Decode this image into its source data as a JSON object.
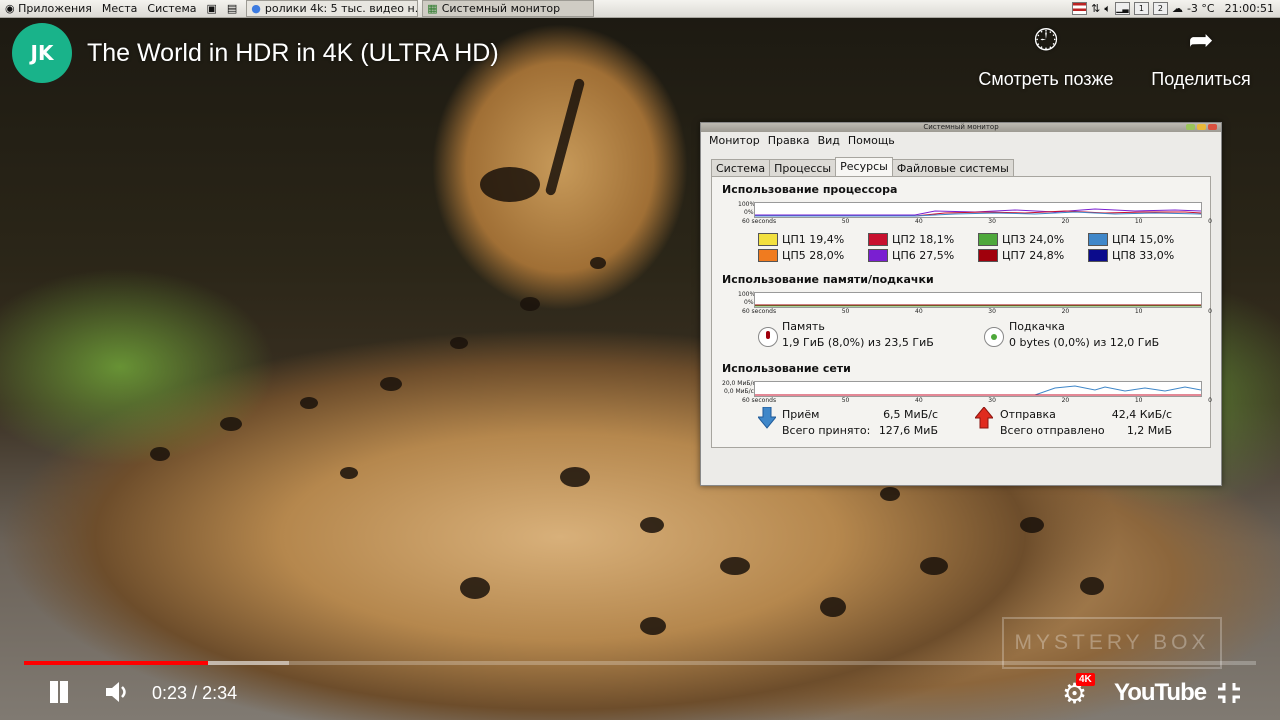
{
  "panel": {
    "menu_apps": "Приложения",
    "menu_places": "Места",
    "menu_system": "Система",
    "task_browser": "ролики 4k: 5 тыс. видео н...",
    "task_monitor": "Системный монитор",
    "weather": "-3 °C",
    "clock": "21:00:51"
  },
  "video": {
    "title": "The World in HDR in 4K (ULTRA HD)",
    "channel_logo_letters": "JK",
    "watch_later": "Смотреть позже",
    "share": "Поделиться",
    "watermark": "MYSTERY BOX",
    "time_current": "0:23",
    "time_total": "2:34",
    "time_separator": " / ",
    "progress_played_pct": 14.9,
    "progress_buffered_pct": 21.5,
    "quality_badge": "4K",
    "brand": "YouTube"
  },
  "monitor": {
    "window_title": "Системный монитор",
    "menu": [
      "Монитор",
      "Правка",
      "Вид",
      "Помощь"
    ],
    "tabs": [
      "Система",
      "Процессы",
      "Ресурсы",
      "Файловые системы"
    ],
    "active_tab": 2,
    "cpu": {
      "heading": "Использование процессора",
      "y_top": "100%",
      "y_bottom": "0%",
      "x_ticks": [
        "60 seconds",
        "50",
        "40",
        "30",
        "20",
        "10",
        "0"
      ],
      "cores": [
        {
          "label": "ЦП1 19,4%",
          "color": "#f2e03e"
        },
        {
          "label": "ЦП2 18,1%",
          "color": "#c8102e"
        },
        {
          "label": "ЦП3 24,0%",
          "color": "#4ea83b"
        },
        {
          "label": "ЦП4 15,0%",
          "color": "#3f87c9"
        },
        {
          "label": "ЦП5 28,0%",
          "color": "#f07b1f"
        },
        {
          "label": "ЦП6 27,5%",
          "color": "#7a1fd1"
        },
        {
          "label": "ЦП7 24,8%",
          "color": "#a0000c"
        },
        {
          "label": "ЦП8 33,0%",
          "color": "#0b0b8c"
        }
      ]
    },
    "memory": {
      "heading": "Использование памяти/подкачки",
      "y_top": "100%",
      "y_bottom": "0%",
      "x_ticks": [
        "60 seconds",
        "50",
        "40",
        "30",
        "20",
        "10",
        "0"
      ],
      "ram_label": "Память",
      "ram_value": "1,9 ГиБ (8,0%) из 23,5 ГиБ",
      "swap_label": "Подкачка",
      "swap_value": "0 bytes (0,0%) из 12,0 ГиБ"
    },
    "network": {
      "heading": "Использование сети",
      "y_top": "20,0 МиБ/с",
      "y_bottom": "0,0 МиБ/с",
      "x_ticks": [
        "60 seconds",
        "50",
        "40",
        "30",
        "20",
        "10",
        "0"
      ],
      "recv_label": "Приём",
      "recv_value": "6,5 МиБ/с",
      "recv_total_label": "Всего принято:",
      "recv_total_value": "127,6 МиБ",
      "send_label": "Отправка",
      "send_value": "42,4 КиБ/с",
      "send_total_label": "Всего отправлено",
      "send_total_value": "1,2 МиБ"
    }
  }
}
